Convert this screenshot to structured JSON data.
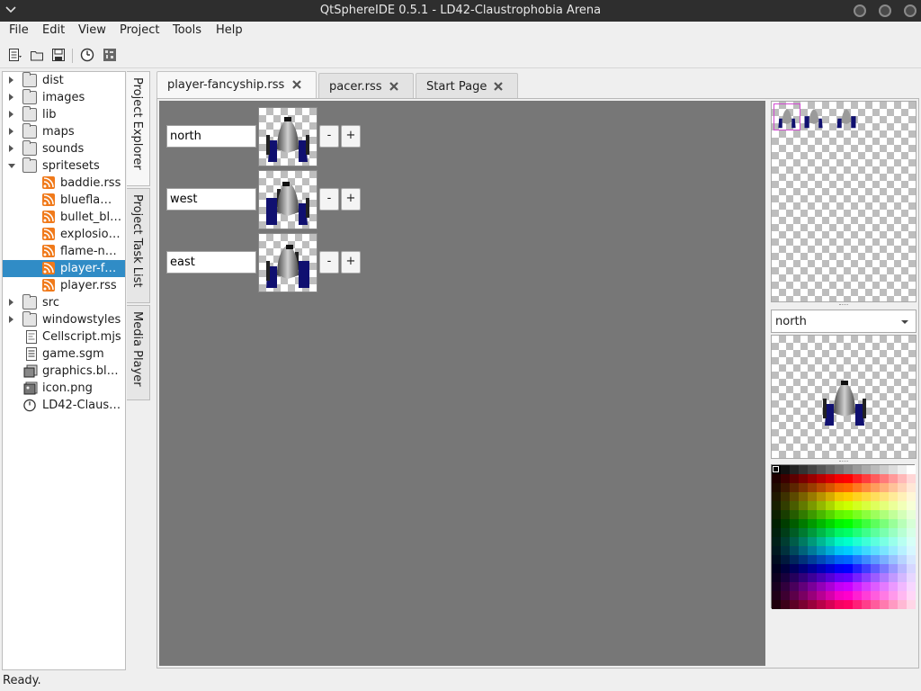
{
  "window": {
    "title": "QtSphereIDE 0.5.1 - LD42-Claustrophobia Arena"
  },
  "menu": [
    "File",
    "Edit",
    "View",
    "Project",
    "Tools",
    "Help"
  ],
  "toolbar": {
    "icons": [
      "new-file-icon",
      "open-folder-icon",
      "save-icon",
      "refresh-icon",
      "test-icon"
    ]
  },
  "tree": {
    "items": [
      {
        "label": "dist",
        "type": "folder",
        "expanded": false
      },
      {
        "label": "images",
        "type": "folder",
        "expanded": false
      },
      {
        "label": "lib",
        "type": "folder",
        "expanded": false
      },
      {
        "label": "maps",
        "type": "folder",
        "expanded": false
      },
      {
        "label": "sounds",
        "type": "folder",
        "expanded": false
      },
      {
        "label": "spritesets",
        "type": "folder",
        "expanded": true
      },
      {
        "label": "baddie.rss",
        "type": "rss",
        "child": true
      },
      {
        "label": "bluefla…",
        "type": "rss",
        "child": true
      },
      {
        "label": "bullet_bl…",
        "type": "rss",
        "child": true
      },
      {
        "label": "explosio…",
        "type": "rss",
        "child": true
      },
      {
        "label": "flame-n…",
        "type": "rss",
        "child": true
      },
      {
        "label": "player-f…",
        "type": "rss",
        "child": true,
        "selected": true
      },
      {
        "label": "player.rss",
        "type": "rss",
        "child": true
      },
      {
        "label": "src",
        "type": "folder",
        "expanded": false
      },
      {
        "label": "windowstyles",
        "type": "folder",
        "expanded": false
      },
      {
        "label": "Cellscript.mjs",
        "type": "script"
      },
      {
        "label": "game.sgm",
        "type": "file"
      },
      {
        "label": "graphics.bl…",
        "type": "file"
      },
      {
        "label": "icon.png",
        "type": "image"
      },
      {
        "label": "LD42-Claus…",
        "type": "project"
      }
    ]
  },
  "side_tabs": [
    "Project Explorer",
    "Project Task List",
    "Media Player"
  ],
  "tabs": [
    {
      "label": "player-fancyship.rss",
      "active": true
    },
    {
      "label": "pacer.rss",
      "active": false
    },
    {
      "label": "Start Page",
      "active": false
    }
  ],
  "directions": [
    {
      "name": "north",
      "minus": "-",
      "plus": "+"
    },
    {
      "name": "west",
      "minus": "-",
      "plus": "+"
    },
    {
      "name": "east",
      "minus": "-",
      "plus": "+"
    }
  ],
  "direction_select": {
    "value": "north"
  },
  "status": {
    "text": "Ready."
  },
  "colors": {
    "selection": "#308cc6",
    "canvas": "#777777",
    "frame_highlight": "#d24bd2"
  }
}
